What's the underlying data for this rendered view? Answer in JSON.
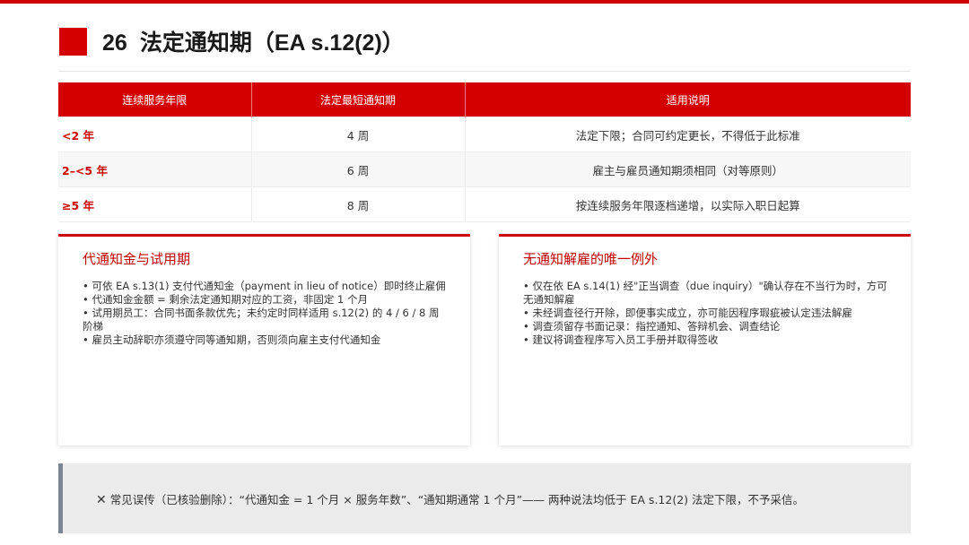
{
  "page": {
    "number": "26",
    "title": "法定通知期（EA s.12(2)）"
  },
  "colors": {
    "accent": "#d40000",
    "callout_bar": "#7b8796",
    "callout_bg": "#ebebeb"
  },
  "table": {
    "headers": [
      "连续服务年限",
      "法定最短通知期",
      "适用说明"
    ],
    "rows": [
      {
        "years": "<2 年",
        "period": "4 周",
        "note": "法定下限；合同可约定更长，不得低于此标准"
      },
      {
        "years": "2–<5 年",
        "period": "6 周",
        "note": "雇主与雇员通知期须相同（对等原则）"
      },
      {
        "years": "≥5 年",
        "period": "8 周",
        "note": "按连续服务年限逐档递增，以实际入职日起算"
      }
    ]
  },
  "cards": {
    "left": {
      "title": "代通知金与试用期",
      "items": [
        "• 可依 EA s.13(1) 支付代通知金（payment in lieu of notice）即时终止雇佣",
        "• 代通知金金额 = 剩余法定通知期对应的工资，非固定 1 个月",
        "• 试用期员工：合同书面条款优先；未约定时同样适用 s.12(2) 的 4 / 6 / 8 周阶梯",
        "• 雇员主动辞职亦须遵守同等通知期，否则须向雇主支付代通知金"
      ]
    },
    "right": {
      "title": "无通知解雇的唯一例外",
      "items": [
        "• 仅在依 EA s.14(1) 经\"正当调查（due inquiry）\"确认存在不当行为时，方可无通知解雇",
        "• 未经调查径行开除，即便事实成立，亦可能因程序瑕疵被认定违法解雇",
        "• 调查须留存书面记录：指控通知、答辩机会、调查结论",
        "• 建议将调查程序写入员工手册并取得签收"
      ]
    }
  },
  "callout": {
    "icon": "cross-icon",
    "icon_glyph": "✕",
    "text": "常见误传（已核验删除）：“代通知金 = 1 个月 × 服务年数”、“通知期通常 1 个月”—— 两种说法均低于 EA s.12(2) 法定下限，不予采信。"
  }
}
